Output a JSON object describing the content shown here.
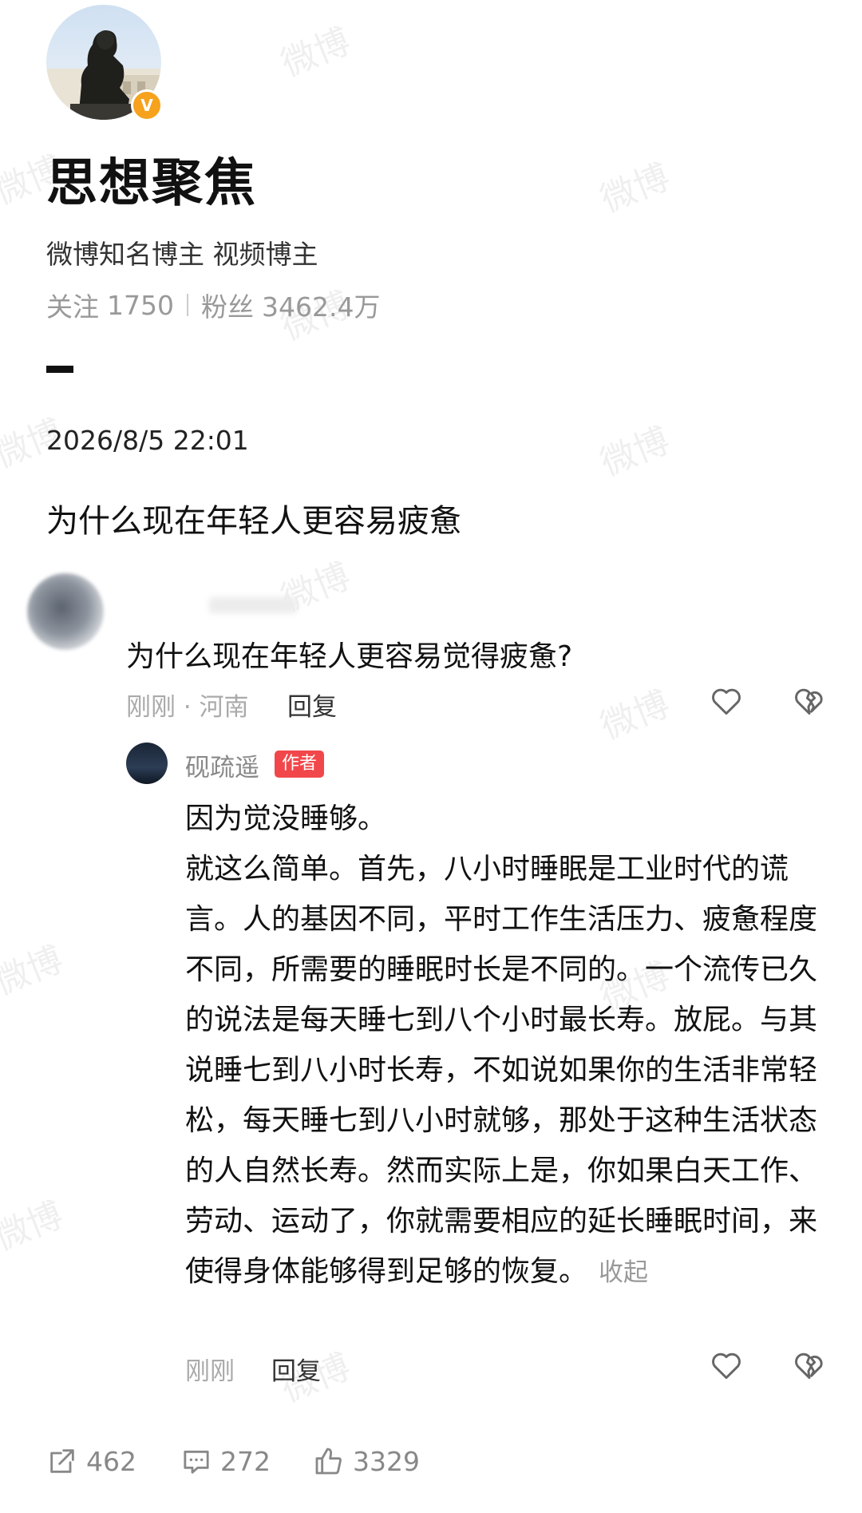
{
  "profile": {
    "name": "思想聚焦",
    "verification": "微博知名博主 视频博主",
    "following_label": "关注",
    "following_count": "1750",
    "followers_label": "粉丝",
    "followers_count": "3462.4万"
  },
  "post": {
    "timestamp": "2026/8/5 22:01",
    "title": "为什么现在年轻人更容易疲惫"
  },
  "comment": {
    "text": "为什么现在年轻人更容易觉得疲惫?",
    "meta": "刚刚 · 河南",
    "reply_label": "回复"
  },
  "reply": {
    "author": "砚疏遥",
    "badge": "作者",
    "paragraph1": "因为觉没睡够。",
    "paragraph2": "就这么简单。首先，八小时睡眠是工业时代的谎言。人的基因不同，平时工作生活压力、疲惫程度不同，所需要的睡眠时长是不同的。一个流传已久的说法是每天睡七到八个小时最长寿。放屁。与其说睡七到八小时长寿，不如说如果你的生活非常轻松，每天睡七到八小时就够，那处于这种生活状态的人自然长寿。然而实际上是，你如果白天工作、劳动、运动了，你就需要相应的延长睡眠时间，来使得身体能够得到足够的恢复。",
    "collapse_label": "收起",
    "meta": "刚刚",
    "reply_label": "回复"
  },
  "actions": {
    "share_count": "462",
    "comment_count": "272",
    "like_count": "3329"
  },
  "watermark": "微博",
  "colors": {
    "badge_red": "#f2474a",
    "verify_orange": "#f6a21d",
    "muted_gray": "#999999"
  }
}
